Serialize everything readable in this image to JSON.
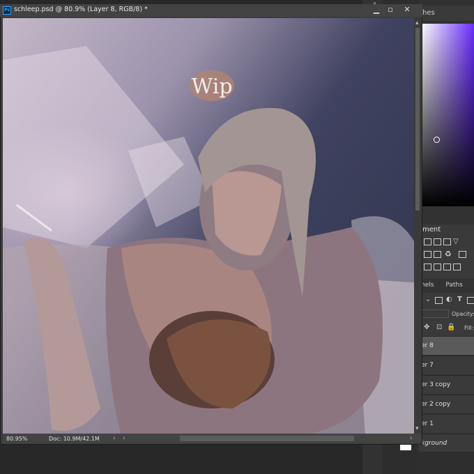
{
  "document": {
    "title": "schleep.psd @ 80.9% (Layer 8, RGB/8) *",
    "annotation": "Wip"
  },
  "status_bar": {
    "zoom": "80.95%",
    "doc_info": "Doc: 10.9M/42.1M"
  },
  "panels": {
    "color_tab": "hes",
    "adjustments_title": "ment",
    "layers_tabs": [
      "nels",
      "Paths"
    ],
    "opacity_label": "Opacity:",
    "fill_label": "Fill:",
    "layers": [
      {
        "name": "er 8",
        "selected": true
      },
      {
        "name": "er 7",
        "selected": false
      },
      {
        "name": "er 3 copy",
        "selected": false
      },
      {
        "name": "er 2 copy",
        "selected": false
      },
      {
        "name": "er 1",
        "selected": false
      },
      {
        "name": "kground",
        "selected": false
      }
    ]
  },
  "colors": {
    "app_bg": "#282828",
    "accent_ps": "#31a8ff",
    "selected_layer": "#5a5a5a"
  }
}
